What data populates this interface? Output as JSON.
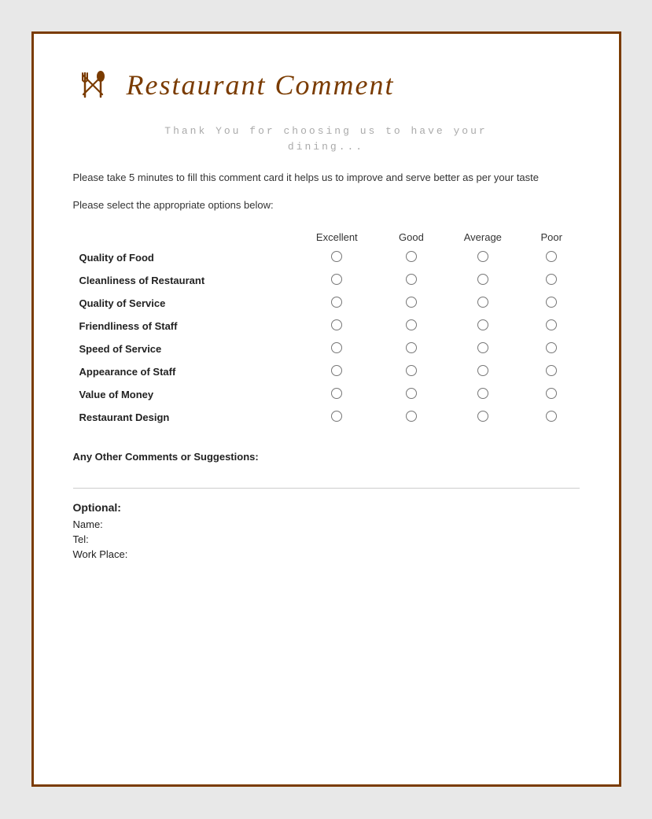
{
  "page": {
    "background": "#e8e8e8",
    "border_color": "#7a3b00"
  },
  "header": {
    "title": "Restaurant Comment",
    "icon_name": "fork-spoon-icon"
  },
  "thank_you": {
    "line1": "Thank You for choosing us to have your",
    "line2": "dining..."
  },
  "description": {
    "text": "Please take 5 minutes to fill this comment card it helps us to improve and serve better as per your taste"
  },
  "instruction": {
    "text": "Please select the appropriate options below:"
  },
  "table": {
    "columns": [
      "",
      "Excellent",
      "Good",
      "Average",
      "Poor"
    ],
    "rows": [
      {
        "label": "Quality of Food"
      },
      {
        "label": "Cleanliness of Restaurant"
      },
      {
        "label": "Quality of Service"
      },
      {
        "label": "Friendliness of Staff"
      },
      {
        "label": "Speed of Service"
      },
      {
        "label": "Appearance of Staff"
      },
      {
        "label": "Value of Money"
      },
      {
        "label": "Restaurant Design"
      }
    ],
    "radio_symbol": "○"
  },
  "comments": {
    "label": "Any Other Comments or Suggestions:"
  },
  "optional": {
    "label": "Optional:",
    "fields": [
      {
        "name": "Name:",
        "value": ""
      },
      {
        "name": "Tel:",
        "value": ""
      },
      {
        "name": "Work Place:",
        "value": ""
      }
    ]
  }
}
